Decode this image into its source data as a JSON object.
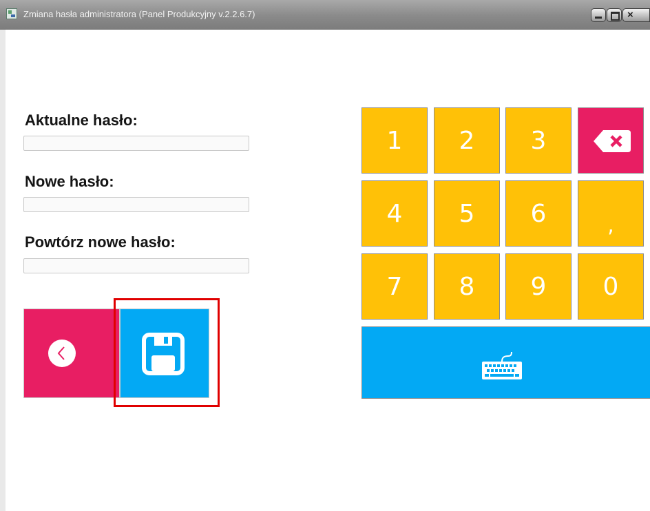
{
  "window": {
    "title": "Zmiana hasła administratora (Panel Produkcyjny v.2.2.6.7)",
    "close_glyph": "×"
  },
  "form": {
    "current_password_label": "Aktualne hasło:",
    "current_password_value": "",
    "new_password_label": "Nowe hasło:",
    "new_password_value": "",
    "repeat_password_label": "Powtórz nowe hasło:",
    "repeat_password_value": ""
  },
  "actions": {
    "back_icon": "chevron-left-icon",
    "save_icon": "floppy-disk-icon",
    "save_highlighted": true
  },
  "keypad": {
    "keys": [
      "1",
      "2",
      "3",
      "4",
      "5",
      "6",
      ",",
      "7",
      "8",
      "9",
      "0"
    ],
    "backspace_icon": "backspace-icon",
    "keyboard_icon": "keyboard-icon"
  },
  "colors": {
    "keypad_key": "#ffc107",
    "accent_pink": "#e81e63",
    "accent_blue": "#03a9f4",
    "highlight": "#e00000"
  }
}
